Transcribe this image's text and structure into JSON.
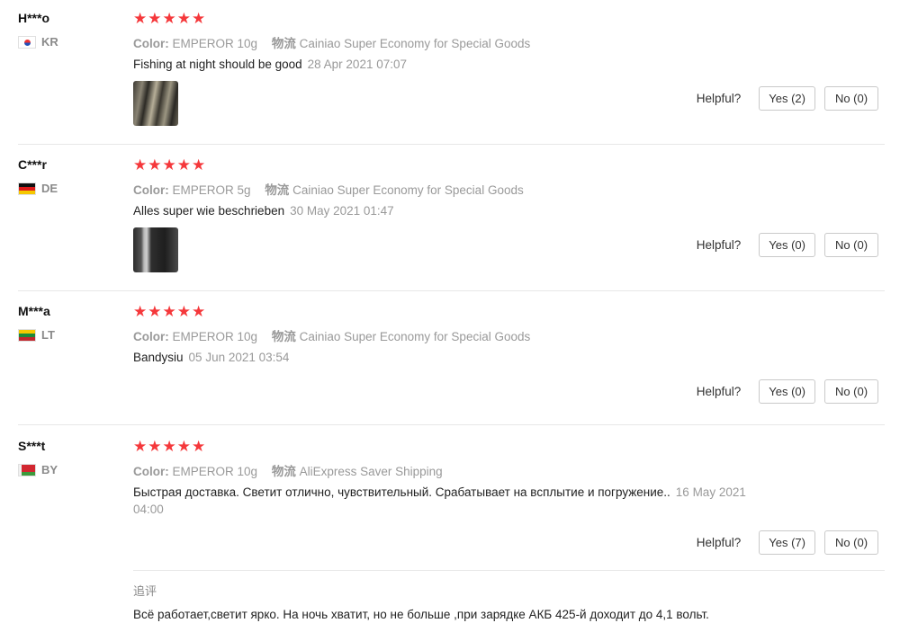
{
  "reviews": [
    {
      "user": "H***o",
      "country": "KR",
      "stars": "★★★★★",
      "color_label": "Color:",
      "color_value": "EMPEROR 10g",
      "shipping_label": "物流",
      "shipping_value": "Cainiao Super Economy for Special Goods",
      "text": "Fishing at night should be good",
      "date": "28 Apr 2021 07:07",
      "helpful_label": "Helpful?",
      "yes": "Yes (2)",
      "no": "No (0)"
    },
    {
      "user": "C***r",
      "country": "DE",
      "stars": "★★★★★",
      "color_label": "Color:",
      "color_value": "EMPEROR 5g",
      "shipping_label": "物流",
      "shipping_value": "Cainiao Super Economy for Special Goods",
      "text": "Alles super wie beschrieben",
      "date": "30 May 2021 01:47",
      "helpful_label": "Helpful?",
      "yes": "Yes (0)",
      "no": "No (0)"
    },
    {
      "user": "M***a",
      "country": "LT",
      "stars": "★★★★★",
      "color_label": "Color:",
      "color_value": "EMPEROR 10g",
      "shipping_label": "物流",
      "shipping_value": "Cainiao Super Economy for Special Goods",
      "text": "Bandysiu",
      "date": "05 Jun 2021 03:54",
      "helpful_label": "Helpful?",
      "yes": "Yes (0)",
      "no": "No (0)"
    },
    {
      "user": "S***t",
      "country": "BY",
      "stars": "★★★★★",
      "color_label": "Color:",
      "color_value": "EMPEROR 10g",
      "shipping_label": "物流",
      "shipping_value": "AliExpress Saver Shipping",
      "text": "Быстрая доставка. Светит отлично, чувствительный. Срабатывает на всплытие и погружение..",
      "date": "16 May 2021 04:00",
      "helpful_label": "Helpful?",
      "yes": "Yes (7)",
      "no": "No (0)",
      "followup_label": "追评",
      "followup_text": "Всё работает,светит ярко. На ночь хватит, но не больше ,при зарядке АКБ 425-й доходит до 4,1 вольт."
    }
  ],
  "colors": {
    "star": "#f5383b",
    "muted": "#999999"
  }
}
